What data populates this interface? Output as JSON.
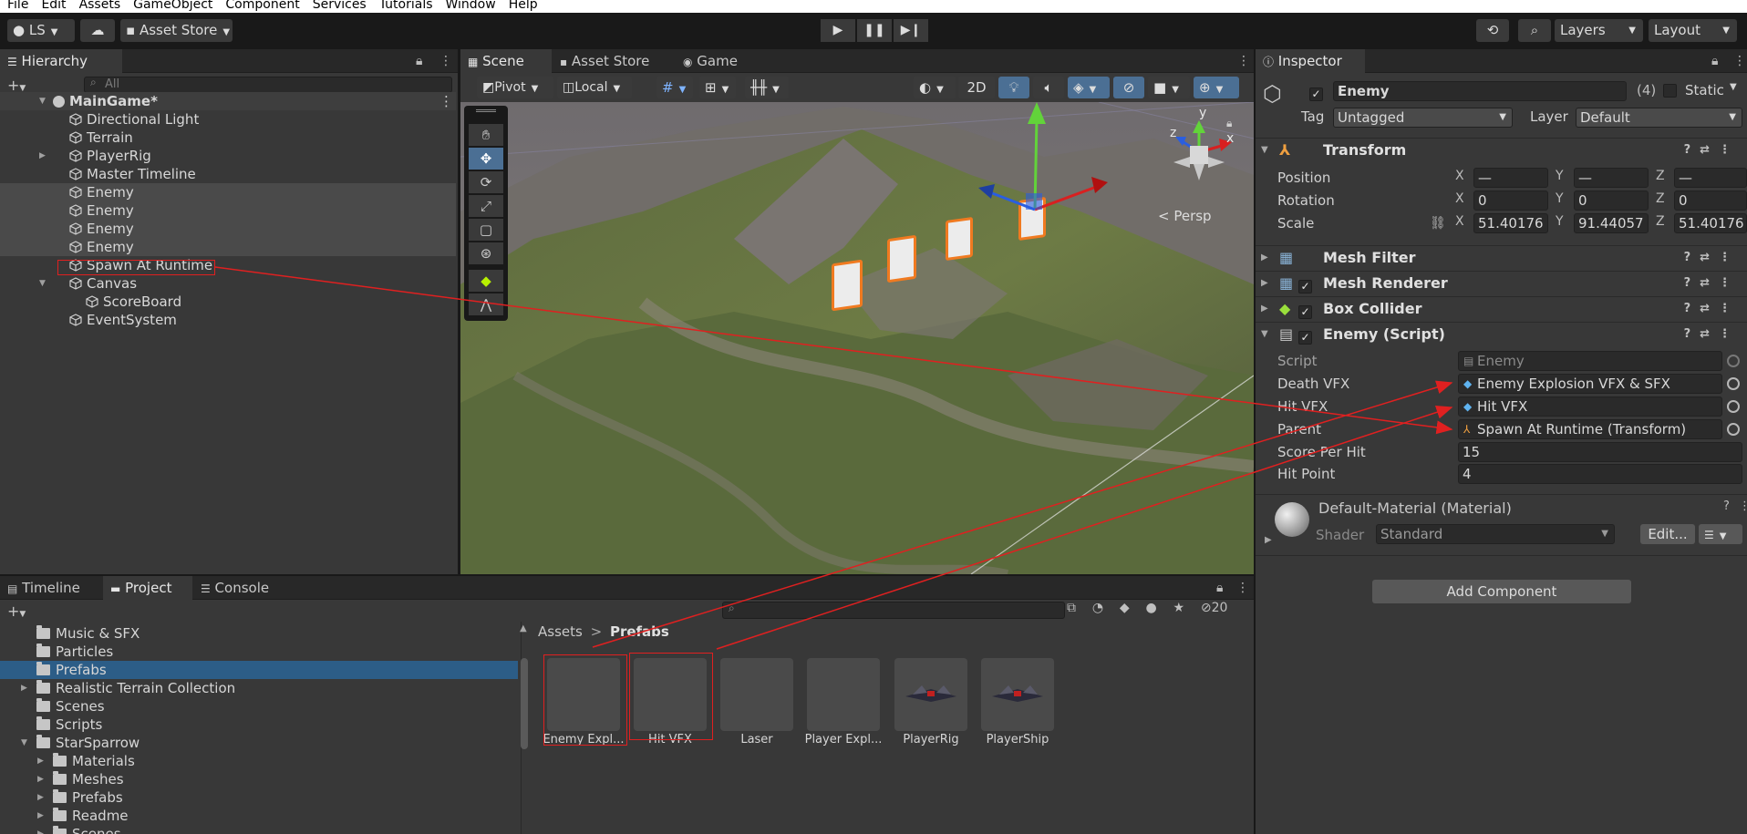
{
  "menu": [
    "File",
    "Edit",
    "Assets",
    "GameObject",
    "Component",
    "Services",
    "Tutorials",
    "Window",
    "Help"
  ],
  "toolbar": {
    "account": "LS",
    "asset_store": "Asset Store",
    "layers": "Layers",
    "layout": "Layout"
  },
  "hierarchy": {
    "tab": "Hierarchy",
    "search_placeholder": "All",
    "scene": "MainGame*",
    "items": [
      {
        "label": "Directional Light"
      },
      {
        "label": "Terrain"
      },
      {
        "label": "PlayerRig"
      },
      {
        "label": "Master Timeline"
      },
      {
        "label": "Enemy"
      },
      {
        "label": "Enemy"
      },
      {
        "label": "Enemy"
      },
      {
        "label": "Enemy"
      },
      {
        "label": "Spawn At Runtime"
      },
      {
        "label": "Canvas"
      },
      {
        "label": "ScoreBoard"
      },
      {
        "label": "EventSystem"
      }
    ]
  },
  "scene_view": {
    "tabs": [
      "Scene",
      "Asset Store",
      "Game"
    ],
    "pivot": "Pivot",
    "local": "Local",
    "two_d": "2D",
    "persp": "< Persp",
    "gizmo_x": "x",
    "gizmo_y": "y",
    "gizmo_z": "z"
  },
  "inspector": {
    "tab": "Inspector",
    "object_name": "Enemy",
    "count": "(4)",
    "static_label": "Static",
    "tag_label": "Tag",
    "tag_value": "Untagged",
    "layer_label": "Layer",
    "layer_value": "Default",
    "transform": {
      "title": "Transform",
      "position_label": "Position",
      "rotation_label": "Rotation",
      "scale_label": "Scale",
      "position": {
        "x": "—",
        "y": "—",
        "z": "—"
      },
      "rotation": {
        "x": "0",
        "y": "0",
        "z": "0"
      },
      "scale": {
        "x": "51.40176",
        "y": "91.44057",
        "z": "51.40176"
      }
    },
    "axis": {
      "x": "X",
      "y": "Y",
      "z": "Z"
    },
    "components": {
      "mesh_filter": "Mesh Filter",
      "mesh_renderer": "Mesh Renderer",
      "box_collider": "Box Collider",
      "enemy_script": "Enemy (Script)"
    },
    "script_fields": {
      "script_label": "Script",
      "script_value": "Enemy",
      "death_vfx_label": "Death VFX",
      "death_vfx_value": "Enemy Explosion VFX & SFX",
      "hit_vfx_label": "Hit VFX",
      "hit_vfx_value": "Hit VFX",
      "parent_label": "Parent",
      "parent_value": "Spawn At Runtime (Transform)",
      "score_label": "Score Per Hit",
      "score_value": "15",
      "hit_point_label": "Hit Point",
      "hit_point_value": "4"
    },
    "material": {
      "name": "Default-Material (Material)",
      "shader_label": "Shader",
      "shader_value": "Standard",
      "edit_button": "Edit..."
    },
    "add_component": "Add Component"
  },
  "bottom": {
    "tabs": [
      "Timeline",
      "Project",
      "Console"
    ],
    "badge_count": "20",
    "folders": [
      {
        "label": "Music & SFX"
      },
      {
        "label": "Particles"
      },
      {
        "label": "Prefabs"
      },
      {
        "label": "Realistic Terrain Collection"
      },
      {
        "label": "Scenes"
      },
      {
        "label": "Scripts"
      },
      {
        "label": "StarSparrow"
      },
      {
        "label": "Materials"
      },
      {
        "label": "Meshes"
      },
      {
        "label": "Prefabs"
      },
      {
        "label": "Readme"
      },
      {
        "label": "Scenes"
      }
    ],
    "breadcrumb_root": "Assets",
    "breadcrumb_current": "Prefabs",
    "assets": [
      {
        "label": "Enemy Expl..."
      },
      {
        "label": "Hit VFX"
      },
      {
        "label": "Laser"
      },
      {
        "label": "Player Expl..."
      },
      {
        "label": "PlayerRig"
      },
      {
        "label": "PlayerShip"
      }
    ]
  }
}
